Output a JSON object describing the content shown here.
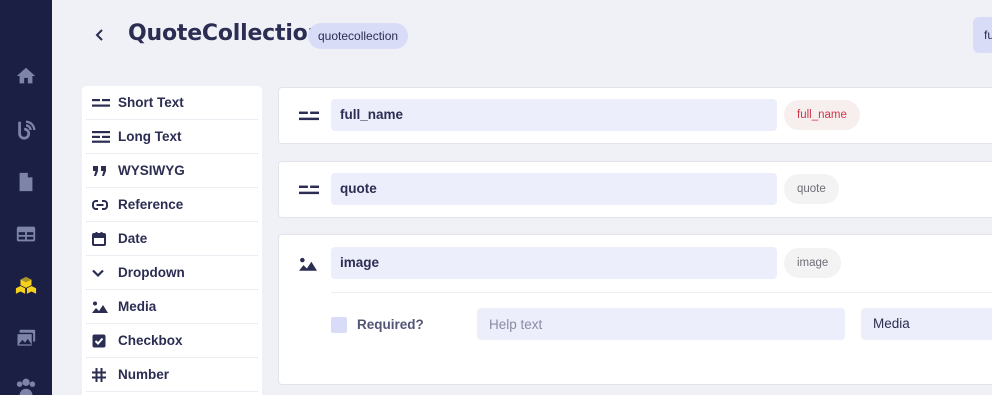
{
  "header": {
    "title": "QuoteCollection",
    "slug": "quotecollection",
    "right_button_label": "fu"
  },
  "sidebar": {
    "items": [
      {
        "icon": "home-icon"
      },
      {
        "icon": "blog-icon"
      },
      {
        "icon": "page-icon"
      },
      {
        "icon": "layout-icon"
      },
      {
        "icon": "collections-icon",
        "active": true
      },
      {
        "icon": "media-icon"
      },
      {
        "icon": "users-icon"
      }
    ],
    "active_color": "#f7d11c",
    "icon_color": "#7e84a8"
  },
  "field_types": [
    {
      "label": "Short Text",
      "icon": "short-text-icon"
    },
    {
      "label": "Long Text",
      "icon": "long-text-icon"
    },
    {
      "label": "WYSIWYG",
      "icon": "quote-icon"
    },
    {
      "label": "Reference",
      "icon": "link-icon"
    },
    {
      "label": "Date",
      "icon": "calendar-icon"
    },
    {
      "label": "Dropdown",
      "icon": "chevron-down-icon"
    },
    {
      "label": "Media",
      "icon": "image-icon"
    },
    {
      "label": "Checkbox",
      "icon": "checkbox-icon"
    },
    {
      "label": "Number",
      "icon": "hash-icon"
    }
  ],
  "fields": [
    {
      "name": "full_name",
      "key": "full_name",
      "type_icon": "short-text-icon",
      "active": true
    },
    {
      "name": "quote",
      "key": "quote",
      "type_icon": "short-text-icon",
      "active": false
    },
    {
      "name": "image",
      "key": "image",
      "type_icon": "image-icon",
      "active": false,
      "expanded": {
        "required_label": "Required?",
        "help_placeholder": "Help text",
        "type_value": "Media"
      }
    }
  ]
}
